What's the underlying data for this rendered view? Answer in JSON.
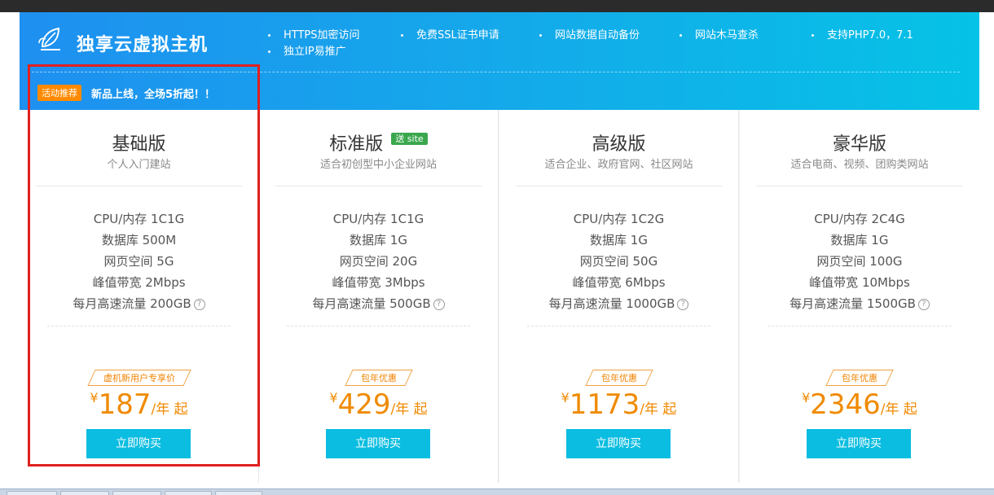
{
  "banner": {
    "brand": "独享云虚拟主机",
    "features": [
      "HTTPS加密访问",
      "免费SSL证书申请",
      "网站数据自动备份",
      "网站木马查杀",
      "支持PHP7.0，7.1",
      "独立IP易推广"
    ],
    "promo_badge": "活动推荐",
    "promo_text": "新品上线，全场5折起！！"
  },
  "plans": [
    {
      "name": "基础版",
      "tag": "",
      "subtitle": "个人入门建站",
      "specs": [
        "CPU/内存 1C1G",
        "数据库 500M",
        "网页空间 5G",
        "峰值带宽 2Mbps",
        "每月高速流量 200GB"
      ],
      "offer": "虚机新用户专享价",
      "currency": "¥",
      "price": "187",
      "unit": "/年 起",
      "button": "立即购买"
    },
    {
      "name": "标准版",
      "tag": "送 site",
      "subtitle": "适合初创型中小企业网站",
      "specs": [
        "CPU/内存 1C1G",
        "数据库 1G",
        "网页空间 20G",
        "峰值带宽 3Mbps",
        "每月高速流量 500GB"
      ],
      "offer": "包年优惠",
      "currency": "¥",
      "price": "429",
      "unit": "/年 起",
      "button": "立即购买"
    },
    {
      "name": "高级版",
      "tag": "",
      "subtitle": "适合企业、政府官网、社区网站",
      "specs": [
        "CPU/内存 1C2G",
        "数据库 1G",
        "网页空间 50G",
        "峰值带宽 6Mbps",
        "每月高速流量 1000GB"
      ],
      "offer": "包年优惠",
      "currency": "¥",
      "price": "1173",
      "unit": "/年 起",
      "button": "立即购买"
    },
    {
      "name": "豪华版",
      "tag": "",
      "subtitle": "适合电商、视频、团购类网站",
      "specs": [
        "CPU/内存 2C4G",
        "数据库 1G",
        "网页空间 100G",
        "峰值带宽 10Mbps",
        "每月高速流量 1500GB"
      ],
      "offer": "包年优惠",
      "currency": "¥",
      "price": "2346",
      "unit": "/年 起",
      "button": "立即购买"
    }
  ],
  "colors": {
    "banner_start": "#1e90f0",
    "banner_end": "#06c2e6",
    "accent_orange": "#f08a00",
    "button": "#0bbde0",
    "highlight_box": "#e02020",
    "site_tag": "#3aa74c"
  },
  "help_icon": "?"
}
